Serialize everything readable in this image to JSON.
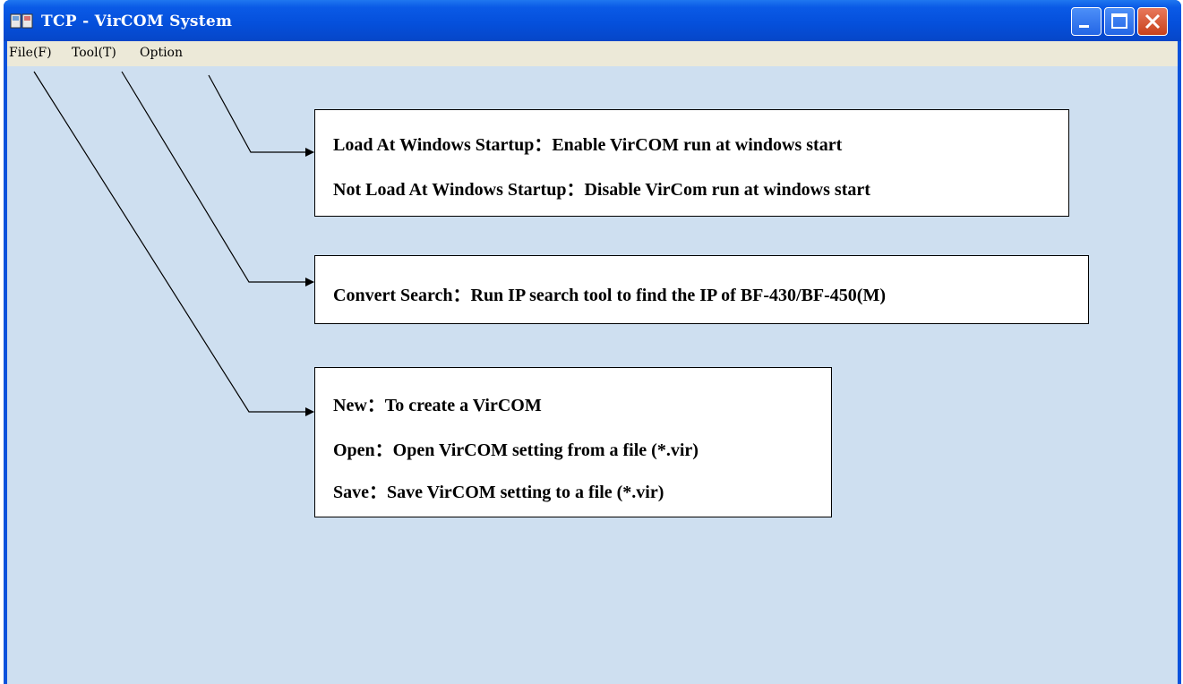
{
  "window": {
    "title": "TCP - VirCOM System",
    "icon": "vircom-app-icon",
    "controls": {
      "minimize": "minimize-icon",
      "maximize": "maximize-icon",
      "close": "close-icon"
    }
  },
  "menu": [
    {
      "label": "File(F)"
    },
    {
      "label": "Tool(T)"
    },
    {
      "label": "Option"
    }
  ],
  "callouts": {
    "option": [
      "Load At Windows Startup：Enable VirCOM run at windows start",
      "Not Load At Windows Startup：Disable VirCom run at windows start"
    ],
    "tool": [
      "Convert Search：Run IP search tool to find the IP of BF-430/BF-450(M)"
    ],
    "file": [
      "New：To create a VirCOM",
      "Open：Open VirCOM setting from a file (*.vir)",
      "Save：Save VirCOM setting to a file (*.vir)"
    ]
  },
  "colors": {
    "titlebar": "#0a52dc",
    "menubar": "#ece9d8",
    "client": "#cedff0",
    "close_button": "#d45a38"
  }
}
